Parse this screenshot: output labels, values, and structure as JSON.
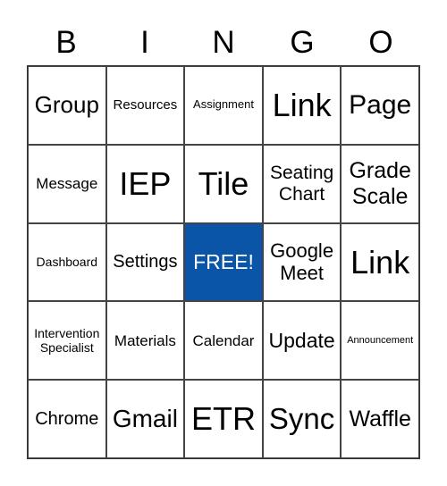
{
  "header": [
    "B",
    "I",
    "N",
    "G",
    "O"
  ],
  "cells": [
    [
      "Group",
      "Resources",
      "Assignment",
      "Link",
      "Page"
    ],
    [
      "Message",
      "IEP",
      "Tile",
      "Seating Chart",
      "Grade Scale"
    ],
    [
      "Dashboard",
      "Settings",
      "FREE!",
      "Google Meet",
      "Link"
    ],
    [
      "Intervention Specialist",
      "Materials",
      "Calendar",
      "Update",
      "Announcement"
    ],
    [
      "Chrome",
      "Gmail",
      "ETR",
      "Sync",
      "Waffle"
    ]
  ],
  "colors": {
    "free_cell": "#0a55a8"
  }
}
